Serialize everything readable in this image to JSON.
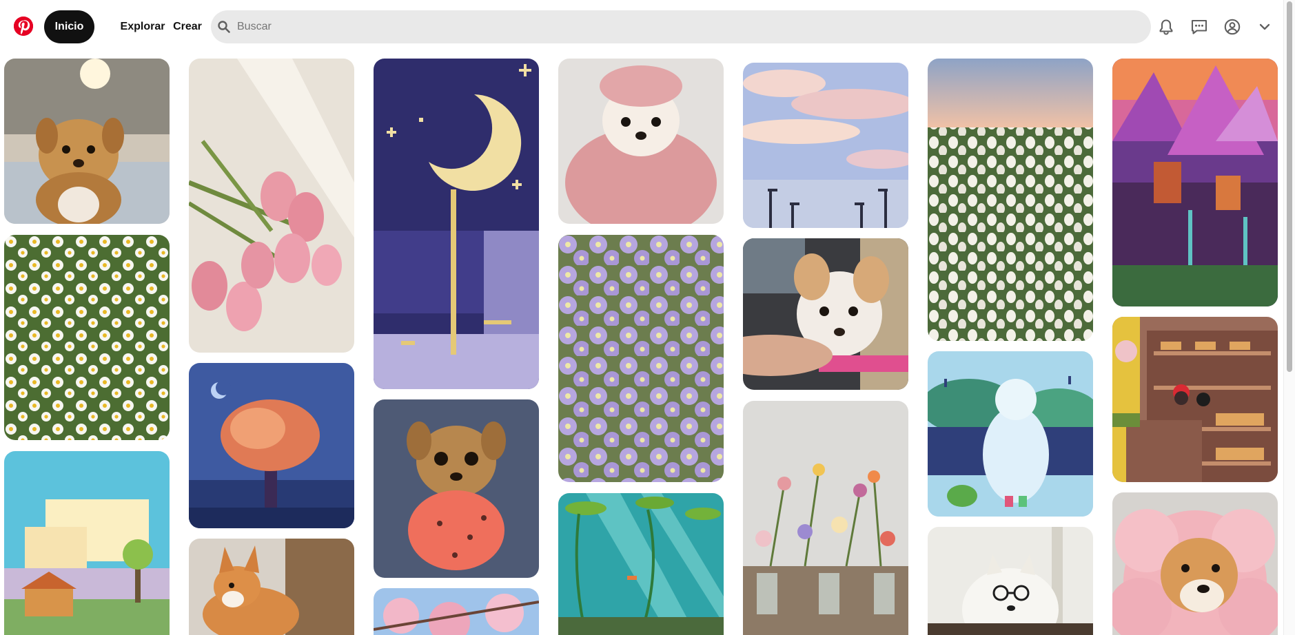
{
  "app": "Pinterest",
  "header": {
    "logo_icon": "pinterest-logo-icon",
    "nav": {
      "home": "Inicio",
      "explore": "Explorar",
      "create": "Crear"
    },
    "search": {
      "placeholder": "Buscar",
      "value": "",
      "icon": "search-icon"
    },
    "actions": [
      {
        "name": "notifications",
        "icon": "bell-icon"
      },
      {
        "name": "messages",
        "icon": "chat-bubble-icon"
      },
      {
        "name": "profile",
        "icon": "account-circle-icon"
      },
      {
        "name": "account-menu",
        "icon": "chevron-down-icon"
      }
    ]
  },
  "colors": {
    "brand_red": "#e60023",
    "home_pill": "#111111",
    "search_bg": "#e9e9e9",
    "icon_gray": "#5f5f5f"
  },
  "pins": [
    {
      "column": 1,
      "subject": "chihuahua on sofa"
    },
    {
      "column": 1,
      "subject": "daisy field"
    },
    {
      "column": 1,
      "subject": "pixel art house with clouds"
    },
    {
      "column": 2,
      "subject": "pink tulips bouquet"
    },
    {
      "column": 2,
      "subject": "pixel art autumn tree at night"
    },
    {
      "column": 2,
      "subject": "corgi on carpet"
    },
    {
      "column": 3,
      "subject": "pixel art crescent moon"
    },
    {
      "column": 3,
      "subject": "chihuahua in pink sweater"
    },
    {
      "column": 3,
      "subject": "cherry blossoms"
    },
    {
      "column": 4,
      "subject": "puppy wrapped in pink towel"
    },
    {
      "column": 4,
      "subject": "purple bellflowers"
    },
    {
      "column": 4,
      "subject": "pixel art underwater pond"
    },
    {
      "column": 5,
      "subject": "pixel art sky with clouds and street lamps"
    },
    {
      "column": 5,
      "subject": "chihuahua in car"
    },
    {
      "column": 5,
      "subject": "wildflowers in vases"
    },
    {
      "column": 6,
      "subject": "white tulip field at sunset"
    },
    {
      "column": 6,
      "subject": "pixel art girl in raincoat with frog"
    },
    {
      "column": 6,
      "subject": "samoyed with glasses"
    },
    {
      "column": 7,
      "subject": "pixel art fantasy cliffs"
    },
    {
      "column": 7,
      "subject": "pixel art bakery"
    },
    {
      "column": 7,
      "subject": "shiba inu flower costume"
    }
  ]
}
